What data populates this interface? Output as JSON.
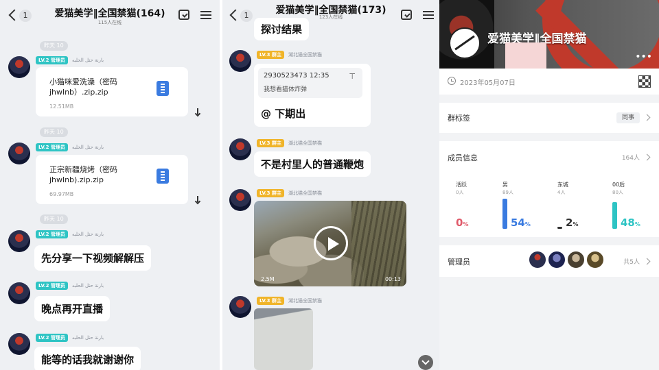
{
  "left_chat": {
    "badge": "1",
    "title": "爱猫美学‖全国禁猫(164)",
    "subtitle": "115人在线",
    "messages": [
      {
        "time": "昨天 10",
        "level": "LV.2 管理员",
        "sender": "بارنة حتل الحلبه",
        "file": "小猫咪爱洗澡（密码\njhwlnb）.zip.zip",
        "size": "12.51MB"
      },
      {
        "time": "昨天 10",
        "level": "LV.2 管理员",
        "sender": "بارنة حتل الحلبه",
        "file": "正宗新疆烧烤（密码\njhwlnb).zip.zip",
        "size": "69.97MB"
      },
      {
        "time": "昨天 10",
        "level": "LV.2 管理员",
        "sender": "بارنة حتل الحلبه",
        "text": "先分享一下视频解解压"
      },
      {
        "level": "LV.2 管理员",
        "sender": "بارنة حتل الحلبه",
        "text": "晚点再开直播"
      },
      {
        "level": "LV.2 管理员",
        "sender": "بارنة حتل الحلبه",
        "text": "能等的话我就谢谢你"
      }
    ]
  },
  "mid_chat": {
    "badge": "1",
    "title": "爱猫美学‖全国禁猫(173)",
    "subtitle": "123人在线",
    "top_text": "探讨结果",
    "quote_head": "2930523473 12:35",
    "quote_body": "我想看猫体炸弹",
    "reply_text": "@ 下期出",
    "level": "LV.3 群主",
    "sender": "湖北猫全国禁猫",
    "text2": "不是村里人的普通鞭炮",
    "video_size": "2.5M",
    "video_time": "00:13"
  },
  "profile": {
    "name": "爱猫美学‖全国禁猫",
    "date": "2023年05月07日",
    "tag_label": "群标签",
    "tag_value": "同事",
    "members_label": "成员信息",
    "members_value": "164人",
    "stats": [
      {
        "name": "活跃",
        "count": "0人",
        "pct": "0",
        "color": "#e05a6a",
        "fill": 0.02
      },
      {
        "name": "男",
        "count": "89人",
        "pct": "54",
        "color": "#3a7be0",
        "fill": 0.54
      },
      {
        "name": "东城",
        "count": "4人",
        "pct": "2",
        "color": "#333333",
        "fill": 0.02
      },
      {
        "name": "00后",
        "count": "80人",
        "pct": "48",
        "color": "#2ec4c4",
        "fill": 0.48
      }
    ],
    "pct_sign": "%",
    "admin_label": "管理员",
    "admin_value": "共5人"
  }
}
